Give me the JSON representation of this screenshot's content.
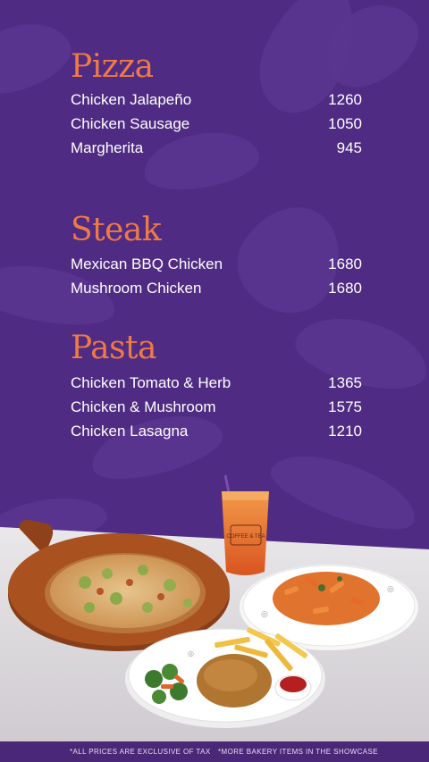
{
  "sections": [
    {
      "title": "Pizza",
      "items": [
        {
          "name": "Chicken Jalapeño",
          "price": "1260"
        },
        {
          "name": "Chicken Sausage",
          "price": "1050"
        },
        {
          "name": "Margherita",
          "price": "945"
        }
      ]
    },
    {
      "title": "Steak",
      "items": [
        {
          "name": "Mexican BBQ Chicken",
          "price": "1680"
        },
        {
          "name": "Mushroom Chicken",
          "price": "1680"
        }
      ]
    },
    {
      "title": "Pasta",
      "items": [
        {
          "name": "Chicken Tomato & Herb",
          "price": "1365"
        },
        {
          "name": "Chicken & Mushroom",
          "price": "1575"
        },
        {
          "name": "Chicken Lasagna",
          "price": "1210"
        }
      ]
    }
  ],
  "cup_brand": "COFFEE & TEA",
  "footer": {
    "left": "*ALL PRICES ARE EXCLUSIVE OF TAX",
    "right": "*MORE BAKERY ITEMS IN THE SHOWCASE"
  },
  "colors": {
    "background": "#4f2b83",
    "accent": "#ef7a44",
    "text": "#ffffff"
  }
}
